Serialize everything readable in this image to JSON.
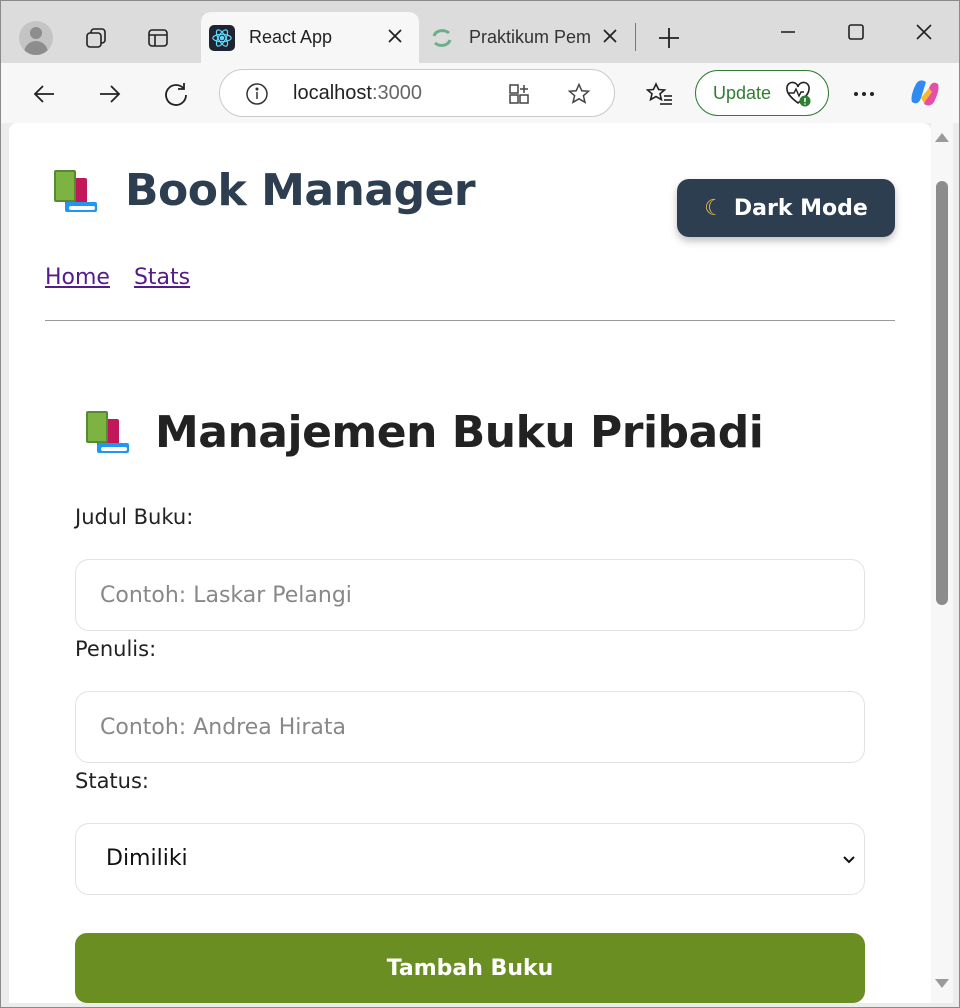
{
  "browser": {
    "tabs": [
      {
        "title": "React App",
        "favicon": "react-icon",
        "active": true
      },
      {
        "title": "Praktikum Pemr",
        "favicon": "sync-icon",
        "active": false
      }
    ],
    "address": {
      "host": "localhost",
      "port": ":3000"
    },
    "update_label": "Update",
    "colors": {
      "update_accent": "#2f7d32"
    }
  },
  "app": {
    "title": "Book Manager",
    "title_icon": "books-icon",
    "dark_mode_label": "Dark Mode",
    "dark_mode_icon": "moon-icon",
    "nav": [
      {
        "label": "Home"
      },
      {
        "label": "Stats"
      }
    ],
    "colors": {
      "primary": "#2c3e50",
      "accent": "#6b8e23",
      "link": "#551a8b"
    }
  },
  "form": {
    "heading": "Manajemen Buku Pribadi",
    "heading_icon": "books-icon",
    "judul": {
      "label": "Judul Buku:",
      "placeholder": "Contoh: Laskar Pelangi",
      "value": ""
    },
    "penulis": {
      "label": "Penulis:",
      "placeholder": "Contoh: Andrea Hirata",
      "value": ""
    },
    "status": {
      "label": "Status:",
      "selected": "Dimiliki"
    },
    "submit_label": "Tambah Buku"
  }
}
